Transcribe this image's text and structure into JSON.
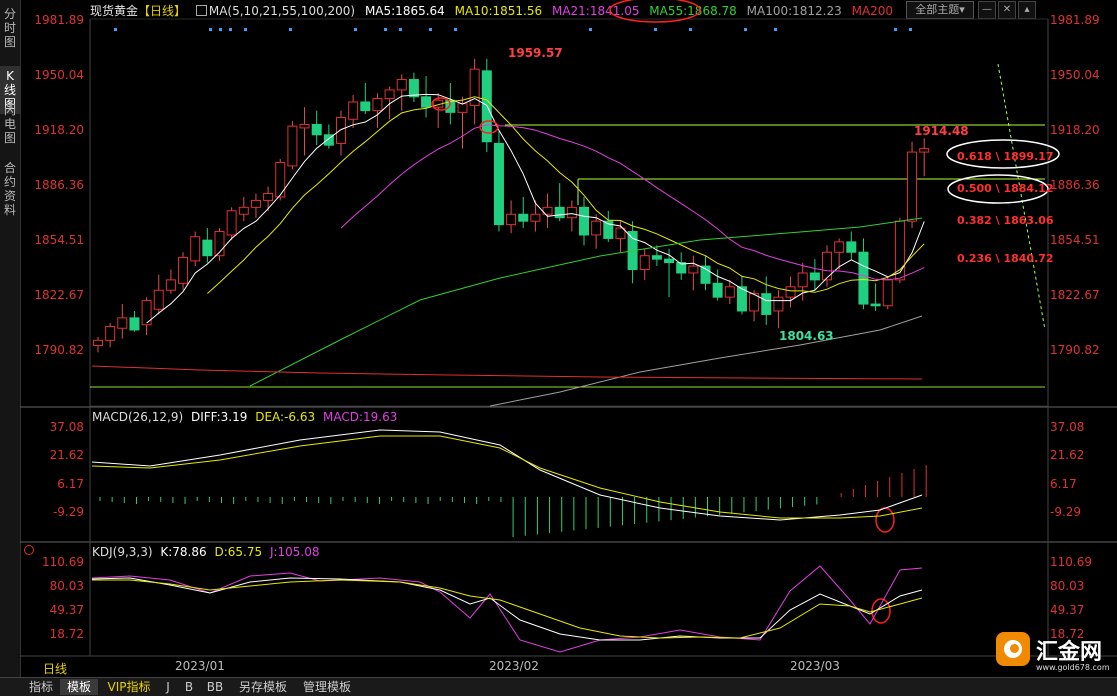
{
  "left_tabs": [
    "分时图",
    "K线图",
    "闪电图",
    "合约资料"
  ],
  "left_tab_active": 1,
  "header": {
    "symbol": "现货黄金",
    "period_tag": "【日线】",
    "ma_params": "MA(5,10,21,55,100,200)",
    "ma5": "MA5:1865.64",
    "ma10": "MA10:1851.56",
    "ma21": "MA21:1841.05",
    "ma55": "MA55:1868.78",
    "ma100": "MA100:1812.23",
    "ma200": "MA200",
    "theme_label": "全部主题",
    "theme_arrow": "▾",
    "ctrl_minus": "—",
    "ctrl_x": "✕",
    "ctrl_up": "▴"
  },
  "colors": {
    "ma5": "#ffffff",
    "ma10": "#e8e800",
    "ma21": "#e040e0",
    "ma55": "#30d030",
    "ma100": "#a0a0a0",
    "ma200": "#e03030",
    "up": "#e03030",
    "down": "#20d080",
    "fib": "#ff3030",
    "axis": "#d33333"
  },
  "main_axis": [
    "1981.89",
    "1950.04",
    "1918.20",
    "1886.36",
    "1854.51",
    "1822.67",
    "1790.82"
  ],
  "annotations": {
    "high": "1959.57",
    "low": "1804.63",
    "last_high": "1914.48"
  },
  "fib_levels": [
    {
      "label": "0.618 \\ 1899.17",
      "level": 1899.17
    },
    {
      "label": "0.500 \\ 1884.12",
      "level": 1884.12
    },
    {
      "label": "0.382 \\ 1863.06",
      "level": 1863.06
    },
    {
      "label": "0.236 \\ 1840.72",
      "level": 1840.72
    }
  ],
  "macd": {
    "title": "MACD(26,12,9)",
    "diff": "DIFF:3.19",
    "dea": "DEA:-6.63",
    "macd": "MACD:19.63",
    "axis": [
      "37.08",
      "21.62",
      "6.17",
      "-9.29"
    ]
  },
  "kdj": {
    "title": "KDJ(9,3,3)",
    "k": "K:78.86",
    "d": "D:65.75",
    "j": "J:105.08",
    "axis": [
      "110.69",
      "80.03",
      "49.37",
      "18.72"
    ]
  },
  "x_labels": [
    "2023/01",
    "2023/02",
    "2023/03"
  ],
  "period_label": "日线",
  "bottom_tabs": [
    "指标",
    "模板",
    "VIP指标",
    "J",
    "B",
    "BB",
    "另存模板",
    "管理模板"
  ],
  "bottom_tab_active": 1,
  "watermark": {
    "text": "汇金网",
    "url": "www.gold678.com"
  },
  "chart_data": {
    "type": "candlestick",
    "ylim": [
      1780,
      1985
    ],
    "candles": [
      [
        1794,
        1799,
        1790,
        1797
      ],
      [
        1797,
        1807,
        1793,
        1805
      ],
      [
        1804,
        1818,
        1798,
        1810
      ],
      [
        1810,
        1814,
        1802,
        1803
      ],
      [
        1806,
        1822,
        1800,
        1820
      ],
      [
        1815,
        1835,
        1812,
        1826
      ],
      [
        1826,
        1838,
        1824,
        1832
      ],
      [
        1830,
        1848,
        1826,
        1845
      ],
      [
        1843,
        1860,
        1840,
        1857
      ],
      [
        1855,
        1862,
        1842,
        1846
      ],
      [
        1846,
        1862,
        1843,
        1860
      ],
      [
        1858,
        1874,
        1855,
        1872
      ],
      [
        1870,
        1880,
        1866,
        1874
      ],
      [
        1874,
        1882,
        1868,
        1878
      ],
      [
        1878,
        1886,
        1872,
        1882
      ],
      [
        1880,
        1902,
        1878,
        1900
      ],
      [
        1898,
        1924,
        1896,
        1921
      ],
      [
        1920,
        1932,
        1904,
        1922
      ],
      [
        1922,
        1930,
        1910,
        1916
      ],
      [
        1916,
        1922,
        1908,
        1910
      ],
      [
        1911,
        1930,
        1904,
        1926
      ],
      [
        1925,
        1939,
        1920,
        1935
      ],
      [
        1935,
        1946,
        1928,
        1930
      ],
      [
        1930,
        1940,
        1920,
        1937
      ],
      [
        1937,
        1944,
        1925,
        1942
      ],
      [
        1942,
        1951,
        1930,
        1948
      ],
      [
        1948,
        1952,
        1935,
        1938
      ],
      [
        1938,
        1950,
        1926,
        1932
      ],
      [
        1932,
        1940,
        1920,
        1936
      ],
      [
        1936,
        1946,
        1922,
        1929
      ],
      [
        1929,
        1938,
        1908,
        1934
      ],
      [
        1933,
        1960,
        1922,
        1954
      ],
      [
        1953,
        1960,
        1906,
        1912
      ],
      [
        1911,
        1918,
        1860,
        1864
      ],
      [
        1864,
        1878,
        1859,
        1870
      ],
      [
        1870,
        1880,
        1862,
        1866
      ],
      [
        1866,
        1878,
        1860,
        1870
      ],
      [
        1870,
        1882,
        1862,
        1874
      ],
      [
        1874,
        1888,
        1866,
        1868
      ],
      [
        1868,
        1878,
        1860,
        1874
      ],
      [
        1874,
        1880,
        1852,
        1858
      ],
      [
        1858,
        1870,
        1850,
        1866
      ],
      [
        1866,
        1872,
        1854,
        1856
      ],
      [
        1856,
        1866,
        1848,
        1862
      ],
      [
        1860,
        1866,
        1830,
        1838
      ],
      [
        1838,
        1850,
        1832,
        1846
      ],
      [
        1846,
        1852,
        1840,
        1844
      ],
      [
        1844,
        1850,
        1822,
        1842
      ],
      [
        1842,
        1848,
        1832,
        1836
      ],
      [
        1836,
        1846,
        1826,
        1840
      ],
      [
        1840,
        1846,
        1826,
        1830
      ],
      [
        1830,
        1838,
        1820,
        1822
      ],
      [
        1822,
        1832,
        1818,
        1828
      ],
      [
        1828,
        1834,
        1812,
        1814
      ],
      [
        1814,
        1826,
        1808,
        1824
      ],
      [
        1824,
        1834,
        1806,
        1812
      ],
      [
        1814,
        1826,
        1804,
        1822
      ],
      [
        1822,
        1834,
        1816,
        1828
      ],
      [
        1828,
        1842,
        1820,
        1836
      ],
      [
        1836,
        1844,
        1826,
        1832
      ],
      [
        1832,
        1852,
        1828,
        1848
      ],
      [
        1848,
        1856,
        1838,
        1854
      ],
      [
        1854,
        1860,
        1844,
        1848
      ],
      [
        1848,
        1856,
        1815,
        1818
      ],
      [
        1818,
        1830,
        1814,
        1817
      ],
      [
        1817,
        1834,
        1815,
        1832
      ],
      [
        1832,
        1868,
        1830,
        1866
      ],
      [
        1866,
        1912,
        1862,
        1906
      ],
      [
        1906,
        1914,
        1892,
        1908
      ]
    ]
  }
}
